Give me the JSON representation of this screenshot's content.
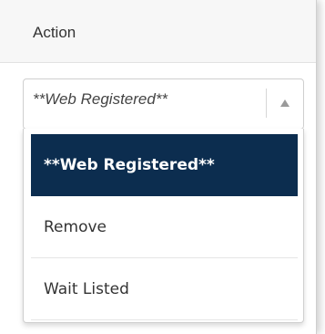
{
  "header": {
    "label": "Action"
  },
  "select": {
    "value": "**Web Registered**",
    "arrow_icon": "triangle-up-icon"
  },
  "dropdown": {
    "options": [
      {
        "label": "**Web Registered**",
        "selected": true
      },
      {
        "label": "Remove",
        "selected": false
      },
      {
        "label": "Wait Listed",
        "selected": false
      }
    ]
  },
  "colors": {
    "selected_bg": "#0c2d4f",
    "selected_text": "#ffffff",
    "header_bg": "#f7f7f7"
  }
}
